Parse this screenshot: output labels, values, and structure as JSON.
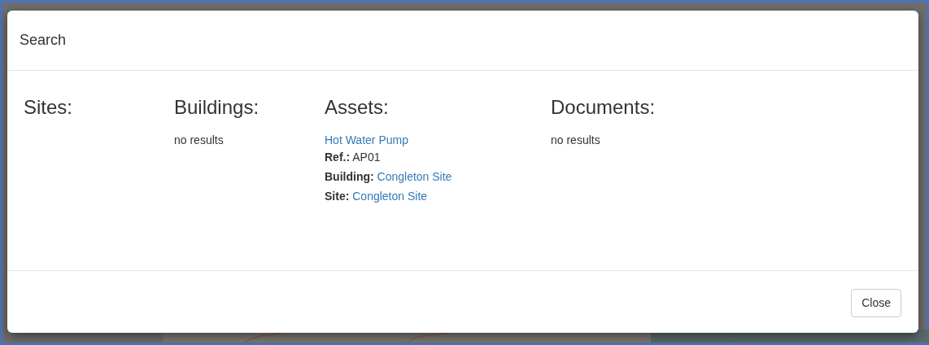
{
  "modal": {
    "title": "Search",
    "sections": [
      {
        "heading": "Sites:"
      },
      {
        "heading": "Buildings:",
        "empty_text": "no results"
      },
      {
        "heading": "Assets:",
        "results": [
          {
            "name": "Hot Water Pump",
            "fields": [
              {
                "label": "Ref.:",
                "value": "AP01",
                "kind": "text"
              },
              {
                "label": "Building:",
                "value": "Congleton Site",
                "kind": "link"
              },
              {
                "label": "Site:",
                "value": "Congleton Site",
                "kind": "link"
              }
            ]
          }
        ]
      },
      {
        "heading": "Documents:",
        "empty_text": "no results"
      }
    ],
    "buttons": [
      "Close"
    ]
  }
}
